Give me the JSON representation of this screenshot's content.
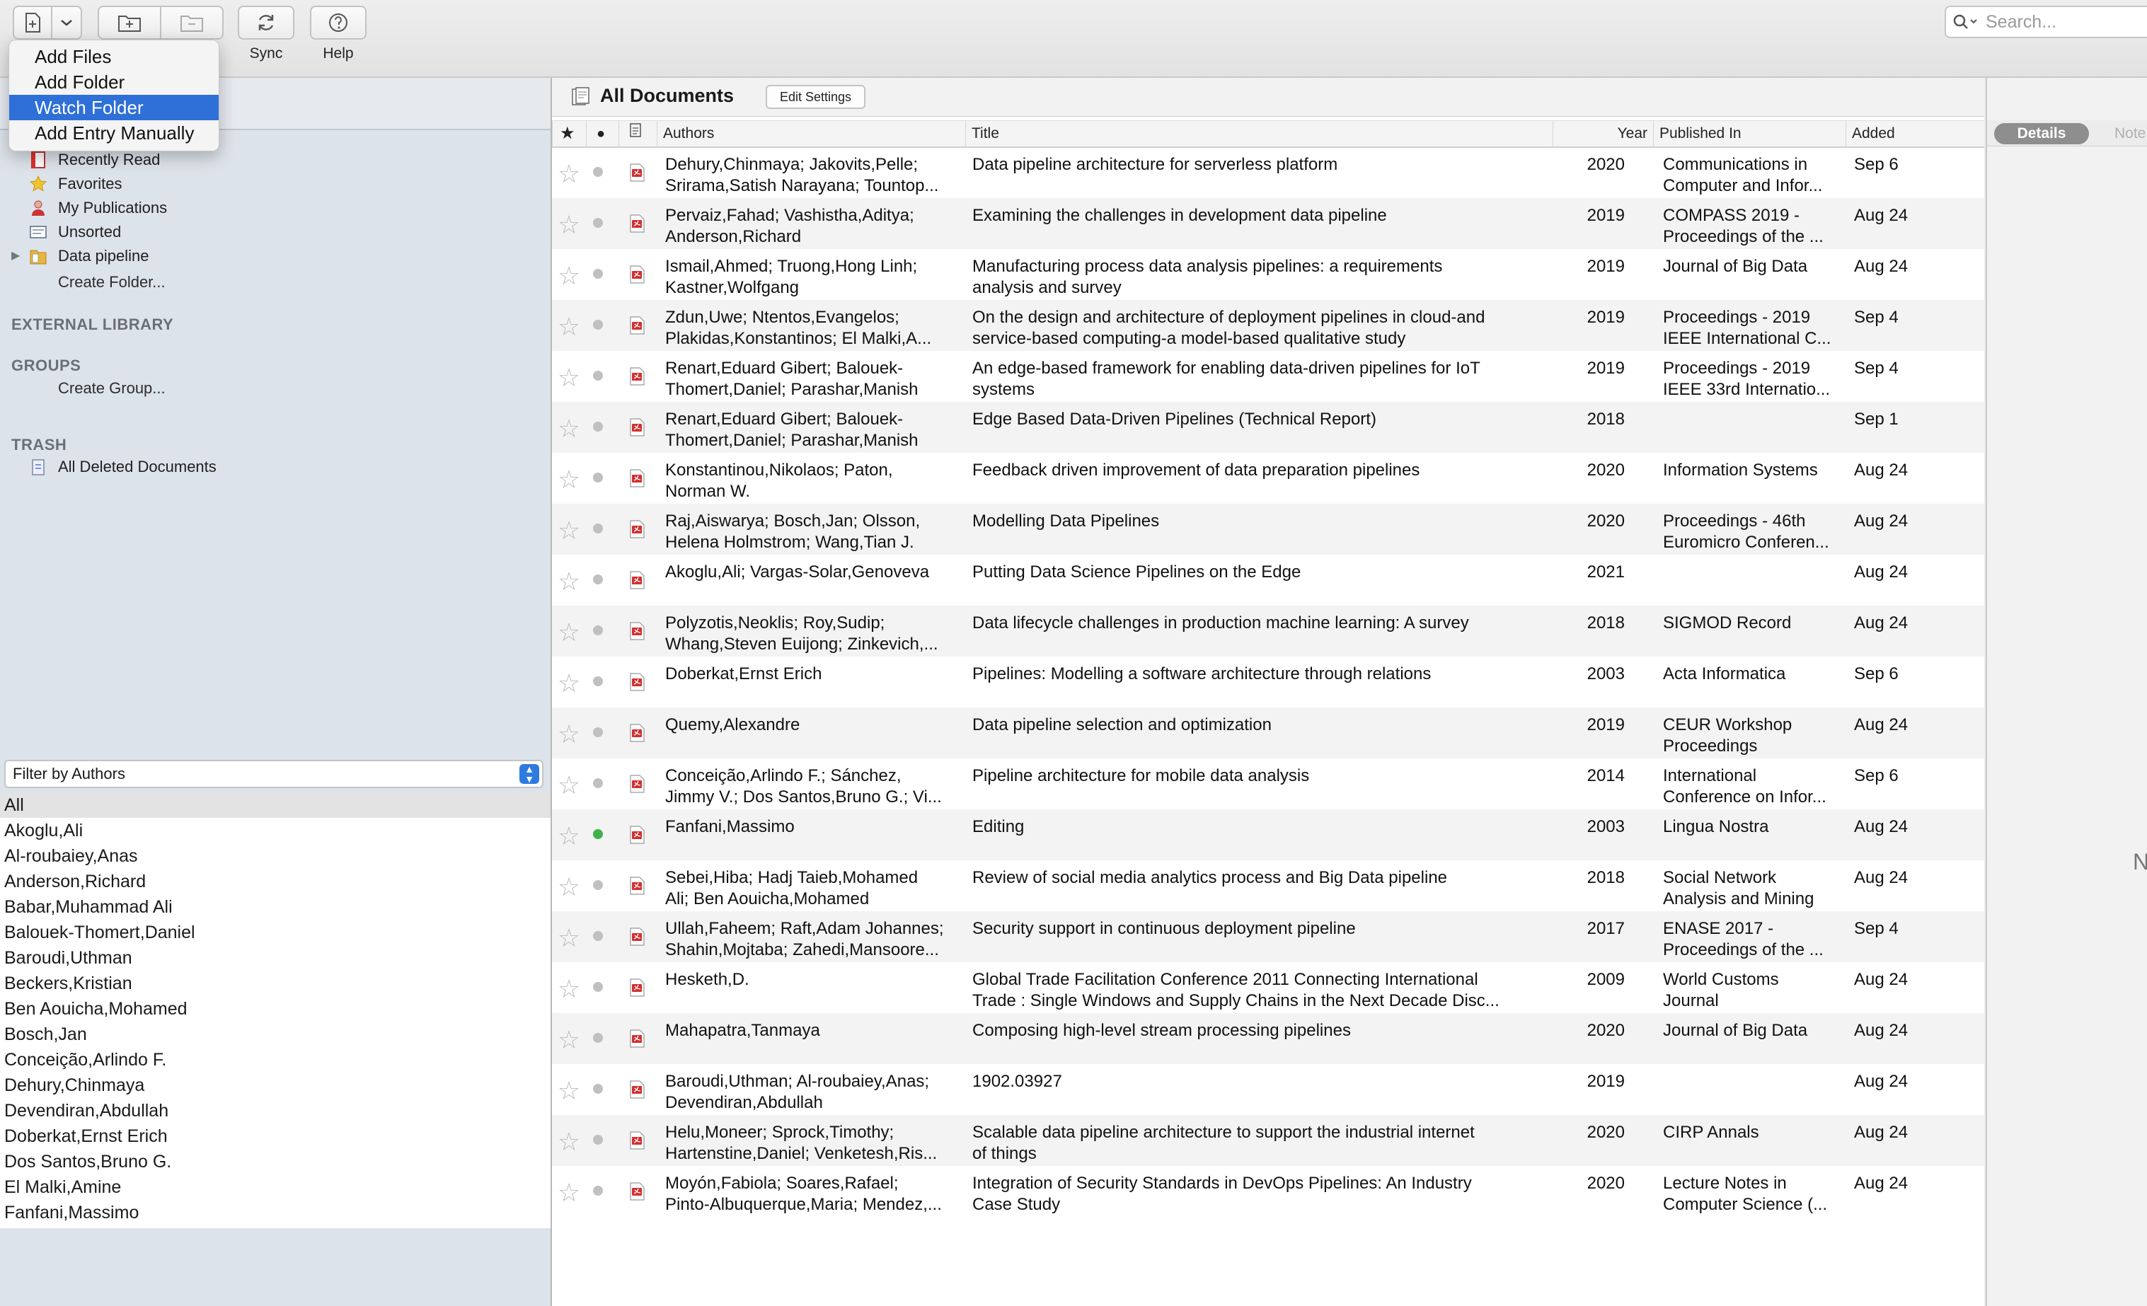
{
  "toolbar": {
    "sync_label": "Sync",
    "help_label": "Help",
    "search_placeholder": "Search..."
  },
  "add_menu": {
    "items": [
      "Add Files",
      "Add Folder",
      "Watch Folder",
      "Add Entry Manually"
    ],
    "selected_index": 2
  },
  "sidebar": {
    "items": [
      "Recently Read",
      "Favorites",
      "My Publications",
      "Unsorted",
      "Data pipeline"
    ],
    "create_folder": "Create Folder...",
    "external_library": "EXTERNAL LIBRARY",
    "groups": "GROUPS",
    "create_group": "Create Group...",
    "trash": "TRASH",
    "deleted_docs": "All Deleted Documents",
    "filter_label": "Filter by Authors",
    "authors": [
      "All",
      "Akoglu,Ali",
      "Al-roubaiey,Anas",
      "Anderson,Richard",
      "Babar,Muhammad Ali",
      "Balouek-Thomert,Daniel",
      "Baroudi,Uthman",
      "Beckers,Kristian",
      "Ben Aouicha,Mohamed",
      "Bosch,Jan",
      "Conceição,Arlindo F.",
      "Dehury,Chinmaya",
      "Devendiran,Abdullah",
      "Doberkat,Ernst Erich",
      "Dos Santos,Bruno G.",
      "El Malki,Amine",
      "Fanfani,Massimo"
    ]
  },
  "main": {
    "title": "All Documents",
    "edit_settings": "Edit Settings",
    "columns": {
      "authors": "Authors",
      "title": "Title",
      "year": "Year",
      "published_in": "Published In",
      "added": "Added"
    },
    "rows": [
      {
        "a1": "Dehury,Chinmaya; Jakovits,Pelle;",
        "a2": "Srirama,Satish Narayana; Tountop...",
        "t1": "Data pipeline architecture for serverless platform",
        "t2": "",
        "year": "2020",
        "p1": "Communications in",
        "p2": "Computer and Infor...",
        "added": "Sep 6",
        "dot": "#c0c0c0"
      },
      {
        "a1": "Pervaiz,Fahad; Vashistha,Aditya;",
        "a2": "Anderson,Richard",
        "t1": "Examining the challenges in development data pipeline",
        "t2": "",
        "year": "2019",
        "p1": "COMPASS 2019 -",
        "p2": "Proceedings of the ...",
        "added": "Aug 24",
        "dot": "#c0c0c0"
      },
      {
        "a1": "Ismail,Ahmed; Truong,Hong Linh;",
        "a2": "Kastner,Wolfgang",
        "t1": "Manufacturing process data analysis pipelines: a requirements",
        "t2": "analysis and survey",
        "year": "2019",
        "p1": "Journal of Big Data",
        "p2": "",
        "added": "Aug 24",
        "dot": "#c0c0c0"
      },
      {
        "a1": "Zdun,Uwe; Ntentos,Evangelos;",
        "a2": "Plakidas,Konstantinos; El Malki,A...",
        "t1": "On the design and architecture of deployment pipelines in cloud-and",
        "t2": "service-based computing-a model-based qualitative study",
        "year": "2019",
        "p1": "Proceedings - 2019",
        "p2": "IEEE International C...",
        "added": "Sep 4",
        "dot": "#c0c0c0"
      },
      {
        "a1": "Renart,Eduard Gibert; Balouek-",
        "a2": "Thomert,Daniel; Parashar,Manish",
        "t1": "An edge-based framework for enabling data-driven pipelines for IoT",
        "t2": "systems",
        "year": "2019",
        "p1": "Proceedings - 2019",
        "p2": "IEEE 33rd Internatio...",
        "added": "Sep 4",
        "dot": "#c0c0c0"
      },
      {
        "a1": "Renart,Eduard Gibert; Balouek-",
        "a2": "Thomert,Daniel; Parashar,Manish",
        "t1": "Edge Based Data-Driven Pipelines (Technical Report)",
        "t2": "",
        "year": "2018",
        "p1": "",
        "p2": "",
        "added": "Sep 1",
        "dot": "#c0c0c0"
      },
      {
        "a1": "Konstantinou,Nikolaos; Paton,",
        "a2": "Norman W.",
        "t1": "Feedback driven improvement of data preparation pipelines",
        "t2": "",
        "year": "2020",
        "p1": "Information Systems",
        "p2": "",
        "added": "Aug 24",
        "dot": "#c0c0c0"
      },
      {
        "a1": "Raj,Aiswarya; Bosch,Jan; Olsson,",
        "a2": "Helena Holmstrom; Wang,Tian J.",
        "t1": "Modelling Data Pipelines",
        "t2": "",
        "year": "2020",
        "p1": "Proceedings - 46th",
        "p2": "Euromicro Conferen...",
        "added": "Aug 24",
        "dot": "#c0c0c0"
      },
      {
        "a1": "Akoglu,Ali; Vargas-Solar,Genoveva",
        "a2": "",
        "t1": "Putting Data Science Pipelines on the Edge",
        "t2": "",
        "year": "2021",
        "p1": "",
        "p2": "",
        "added": "Aug 24",
        "dot": "#c0c0c0"
      },
      {
        "a1": "Polyzotis,Neoklis; Roy,Sudip;",
        "a2": "Whang,Steven Euijong; Zinkevich,...",
        "t1": "Data lifecycle challenges in production machine learning: A survey",
        "t2": "",
        "year": "2018",
        "p1": "SIGMOD Record",
        "p2": "",
        "added": "Aug 24",
        "dot": "#c0c0c0"
      },
      {
        "a1": "Doberkat,Ernst Erich",
        "a2": "",
        "t1": "Pipelines: Modelling a software architecture through relations",
        "t2": "",
        "year": "2003",
        "p1": "Acta Informatica",
        "p2": "",
        "added": "Sep 6",
        "dot": "#c0c0c0"
      },
      {
        "a1": "Quemy,Alexandre",
        "a2": "",
        "t1": "Data pipeline selection and optimization",
        "t2": "",
        "year": "2019",
        "p1": "CEUR Workshop",
        "p2": "Proceedings",
        "added": "Aug 24",
        "dot": "#c0c0c0"
      },
      {
        "a1": "Conceição,Arlindo F.; Sánchez,",
        "a2": "Jimmy V.; Dos Santos,Bruno G.; Vi...",
        "t1": "Pipeline architecture for mobile data analysis",
        "t2": "",
        "year": "2014",
        "p1": "International",
        "p2": "Conference on Infor...",
        "added": "Sep 6",
        "dot": "#c0c0c0"
      },
      {
        "a1": "Fanfani,Massimo",
        "a2": "",
        "t1": "Editing",
        "t2": "",
        "year": "2003",
        "p1": "Lingua Nostra",
        "p2": "",
        "added": "Aug 24",
        "dot": "#3fb24a"
      },
      {
        "a1": "Sebei,Hiba; Hadj Taieb,Mohamed",
        "a2": "Ali; Ben Aouicha,Mohamed",
        "t1": "Review of social media analytics process and Big Data pipeline",
        "t2": "",
        "year": "2018",
        "p1": "Social Network",
        "p2": "Analysis and Mining",
        "added": "Aug 24",
        "dot": "#c0c0c0"
      },
      {
        "a1": "Ullah,Faheem; Raft,Adam Johannes;",
        "a2": "Shahin,Mojtaba; Zahedi,Mansoore...",
        "t1": "Security support in continuous deployment pipeline",
        "t2": "",
        "year": "2017",
        "p1": "ENASE 2017 -",
        "p2": "Proceedings of the ...",
        "added": "Sep 4",
        "dot": "#c0c0c0"
      },
      {
        "a1": "Hesketh,D.",
        "a2": "",
        "t1": "Global Trade Facilitation Conference 2011 Connecting International",
        "t2": "Trade : Single Windows and Supply Chains in the Next Decade Disc...",
        "year": "2009",
        "p1": "World Customs",
        "p2": "Journal",
        "added": "Aug 24",
        "dot": "#c0c0c0"
      },
      {
        "a1": "Mahapatra,Tanmaya",
        "a2": "",
        "t1": "Composing high-level stream processing pipelines",
        "t2": "",
        "year": "2020",
        "p1": "Journal of Big Data",
        "p2": "",
        "added": "Aug 24",
        "dot": "#c0c0c0"
      },
      {
        "a1": "Baroudi,Uthman; Al-roubaiey,Anas;",
        "a2": "Devendiran,Abdullah",
        "t1": "1902.03927",
        "t2": "",
        "year": "2019",
        "p1": "",
        "p2": "",
        "added": "Aug 24",
        "dot": "#c0c0c0"
      },
      {
        "a1": "Helu,Moneer; Sprock,Timothy;",
        "a2": "Hartenstine,Daniel; Venketesh,Ris...",
        "t1": "Scalable data pipeline architecture to support the industrial internet",
        "t2": "of things",
        "year": "2020",
        "p1": "CIRP Annals",
        "p2": "",
        "added": "Aug 24",
        "dot": "#c0c0c0"
      },
      {
        "a1": "Moyón,Fabiola; Soares,Rafael;",
        "a2": "Pinto-Albuquerque,Maria; Mendez,...",
        "t1": "Integration of Security Standards in DevOps Pipelines: An Industry",
        "t2": "Case Study",
        "year": "2020",
        "p1": "Lecture Notes in",
        "p2": "Computer Science (...",
        "added": "Aug 24",
        "dot": "#c0c0c0"
      }
    ]
  },
  "right_panel": {
    "details_tab": "Details",
    "notes_tab": "Note",
    "edge_letter": "N"
  },
  "colors": {
    "accent": "#2e6fd8",
    "pdf_red": "#d32f2f",
    "read_green": "#3fb24a"
  }
}
